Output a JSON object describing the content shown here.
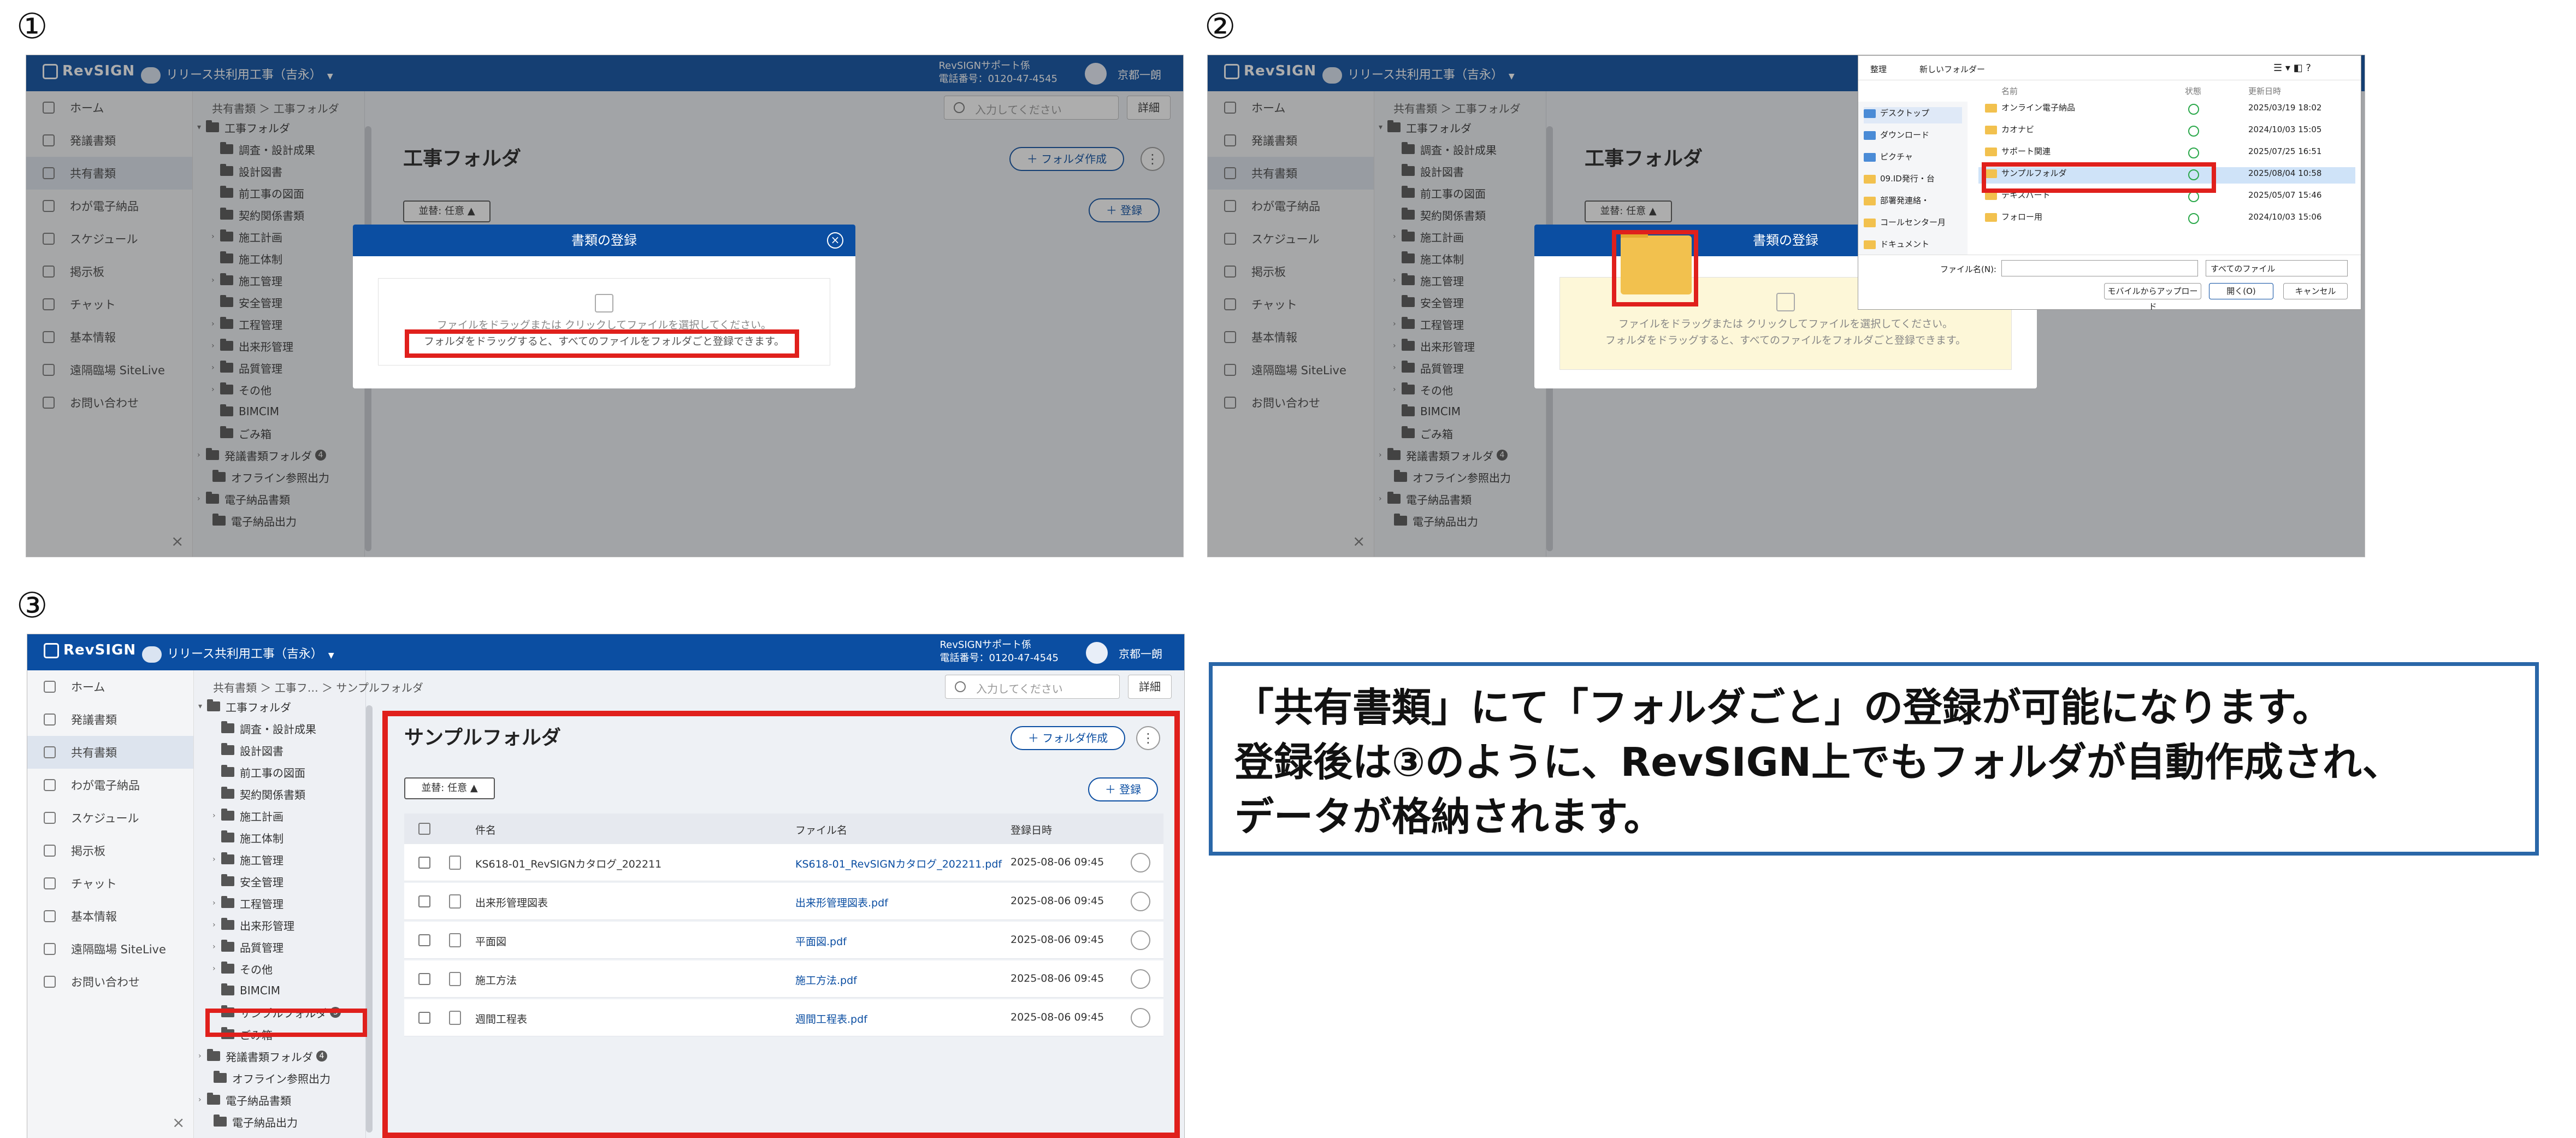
{
  "labels": {
    "n1": "①",
    "n2": "②",
    "n3": "③"
  },
  "colors": {
    "brand": "#0b4ea2",
    "highlight": "#e0201c",
    "callout_border": "#2a67a8",
    "drop_zone_yellow": "#fdf7d8"
  },
  "app": {
    "brand": "RevSIGN",
    "project": "リリース共利用工事（吉永）",
    "support_line1": "RevSIGNサポート係",
    "support_line2": "電話番号：0120-47-4545",
    "user": "京都一朗",
    "search_placeholder": "入力してください",
    "detail_label": "詳細"
  },
  "nav": [
    "ホーム",
    "発議書類",
    "共有書類",
    "わが電子納品",
    "スケジュール",
    "掲示板",
    "チャット",
    "基本情報",
    "遠隔臨場 SiteLive",
    "お問い合わせ"
  ],
  "nav_icons": [
    "home-icon",
    "document-icon",
    "share-icon",
    "delivery-icon",
    "calendar-icon",
    "board-icon",
    "chat-icon",
    "info-icon",
    "camera-icon",
    "help-icon"
  ],
  "tree": {
    "root": "工事フォルダ",
    "children": [
      "調査・設計成果",
      "設計図書",
      "前工事の図面",
      "契約関係書類",
      "施工計画",
      "施工体制",
      "施工管理",
      "安全管理",
      "工程管理",
      "出来形管理",
      "品質管理",
      "その他",
      "BIMCIM"
    ],
    "trash": "ごみ箱",
    "proposal_folder": "発議書類フォルダ",
    "proposal_badge": "4",
    "offline_export": "オフライン参照出力",
    "e_delivery_docs": "電子納品書類",
    "e_delivery_export": "電子納品出力",
    "sample_folder": "サンプルフォルダ",
    "sample_badge": "5"
  },
  "screen1": {
    "breadcrumb": "共有書類 ＞ 工事フォルダ",
    "title": "工事フォルダ",
    "create_folder": "フォルダ作成",
    "register": "登録",
    "sort": "並替: 任意",
    "modal_title": "書類の登録",
    "drop_line1": "ファイルをドラッグまたは クリックしてファイルを選択してください。",
    "drop_line2": "フォルダをドラッグすると、すべてのファイルをフォルダごと登録できます。"
  },
  "screen2": {
    "drop_line1": "ファイルをドラッグまたは クリックしてファイルを選択してください。",
    "drop_line2": "フォルダをドラッグすると、すべてのファイルをフォルダごと登録できます。",
    "dialog": {
      "organize": "整理",
      "new_folder": "新しいフォルダー",
      "col_name": "名前",
      "col_status": "状態",
      "col_date": "更新日時",
      "quick_access": [
        "デスクトップ",
        "ダウンロード",
        "ピクチャ",
        "09.ID発行・台",
        "部署発連絡・",
        "コールセンター月",
        "ドキュメント"
      ],
      "files": [
        {
          "name": "オンライン電子納品",
          "date": "2025/03/19 18:02"
        },
        {
          "name": "カオナビ",
          "date": "2024/10/03 15:05"
        },
        {
          "name": "サポート関連",
          "date": "2025/07/25 16:51"
        },
        {
          "name": "サンプルフォルダ",
          "date": "2025/08/04 10:58"
        },
        {
          "name": "テキスパート",
          "date": "2025/05/07 15:46"
        },
        {
          "name": "フォロー用",
          "date": "2024/10/03 15:06"
        }
      ],
      "filename_label": "ファイル名(N):",
      "filter": "すべてのファイル",
      "upload_mobile": "モバイルからアップロード",
      "open": "開く(O)",
      "cancel": "キャンセル"
    }
  },
  "screen3": {
    "breadcrumb": "共有書類 ＞ 工事フ… ＞ サンプルフォルダ",
    "title": "サンプルフォルダ",
    "create_folder": "フォルダ作成",
    "register": "登録",
    "sort": "並替: 任意",
    "columns": [
      "件名",
      "ファイル名",
      "登録日時"
    ],
    "rows": [
      {
        "subject": "KS618-01_RevSIGNカタログ_202211",
        "file": "KS618-01_RevSIGNカタログ_202211.pdf",
        "date": "2025-08-06 09:45"
      },
      {
        "subject": "出来形管理図表",
        "file": "出来形管理図表.pdf",
        "date": "2025-08-06 09:45"
      },
      {
        "subject": "平面図",
        "file": "平面図.pdf",
        "date": "2025-08-06 09:45"
      },
      {
        "subject": "施工方法",
        "file": "施工方法.pdf",
        "date": "2025-08-06 09:45"
      },
      {
        "subject": "週間工程表",
        "file": "週間工程表.pdf",
        "date": "2025-08-06 09:45"
      }
    ]
  },
  "callout": {
    "line1": "「共有書類」にて「フォルダごと」の登録が可能になります。",
    "line2": "登録後は③のように、RevSIGN上でもフォルダが自動作成され、",
    "line3": "データが格納されます。"
  }
}
